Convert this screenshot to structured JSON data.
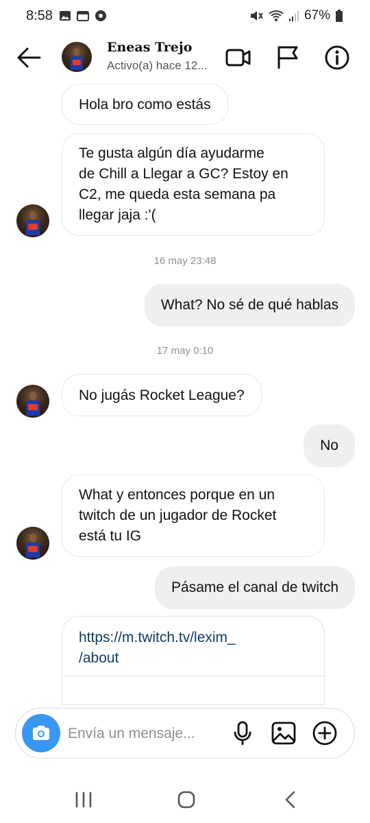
{
  "status_bar": {
    "time": "8:58",
    "battery": "67%"
  },
  "header": {
    "name": "Eneas Trejo",
    "status": "Activo(a) hace 12..."
  },
  "messages": [
    {
      "direction": "incoming",
      "text": "Hola bro como estás"
    },
    {
      "direction": "incoming",
      "text": "Te gusta algún día ayudarme\nde Chill a Llegar a GC? Estoy en\nC2, me queda esta semana pa\nllegar jaja :'("
    },
    {
      "direction": "timestamp",
      "text": "16 may 23:48"
    },
    {
      "direction": "outgoing",
      "text": "What? No sé de qué hablas"
    },
    {
      "direction": "timestamp",
      "text": "17 may 0:10"
    },
    {
      "direction": "incoming",
      "text": "No jugás Rocket League?"
    },
    {
      "direction": "outgoing",
      "text": "No"
    },
    {
      "direction": "incoming",
      "text": "What y entonces porque en un\ntwitch de un jugador de Rocket\nestá tu IG"
    },
    {
      "direction": "outgoing",
      "text": "Pásame el canal de twitch"
    },
    {
      "direction": "incoming_link",
      "text": "https://m.twitch.tv/lexim_\n/about"
    }
  ],
  "composer": {
    "placeholder": "Envía un mensaje..."
  },
  "colors": {
    "accent": "#3897f0",
    "outgoing_bubble": "#efefef",
    "link": "#0d3c61"
  }
}
